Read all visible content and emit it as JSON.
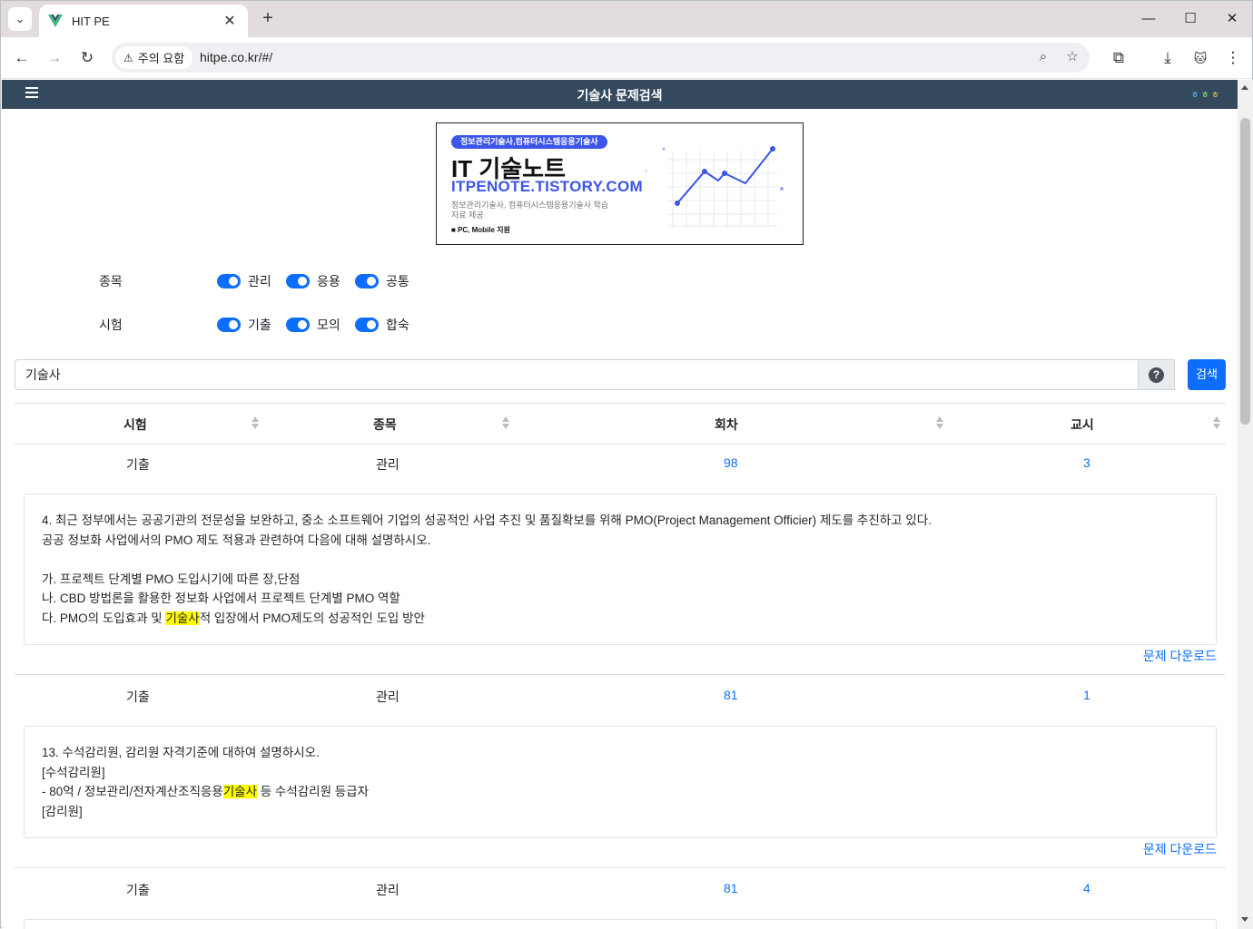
{
  "browser": {
    "tab_title": "HIT PE",
    "security_chip": "주의 요함",
    "url": "hitpe.co.kr/#/"
  },
  "app": {
    "title": "기술사 문제검색",
    "nav_deco": "ㅎㅎㅎ"
  },
  "banner": {
    "pill": "정보관리기술사,컴퓨터시스템응용기술사",
    "headline": "IT 기술노트",
    "site": "ITPENOTE.TISTORY.COM",
    "sub": "정보관리기술사, 컴퓨터시스템응용기술사 학습자료 제공",
    "platform": "■ PC, Mobile 지원"
  },
  "filters": {
    "category": {
      "label": "종목",
      "options": [
        "관리",
        "응용",
        "공통"
      ]
    },
    "exam": {
      "label": "시험",
      "options": [
        "기출",
        "모의",
        "합숙"
      ]
    }
  },
  "search": {
    "value": "기술사",
    "help": "?",
    "button": "검색"
  },
  "table": {
    "headers": [
      "시험",
      "종목",
      "회차",
      "교시"
    ],
    "rows": [
      {
        "exam": "기출",
        "category": "관리",
        "round": "98",
        "period": "3",
        "lines": [
          "4. 최근 정부에서는 공공기관의 전문성을 보완하고, 중소 소프트웨어 기업의 성공적인 사업 추진 및 품질확보를 위해 PMO(Project Management Officier) 제도를 추진하고 있다.",
          "공공 정보화 사업에서의 PMO 제도 적용과 관련하여 다음에 대해 설명하시오.",
          "",
          "가. 프로젝트 단계별 PMO 도입시기에 따른 장,단점",
          "나. CBD 방법론을 활용한 정보화 사업에서 프로젝트 단계별 PMO 역할"
        ],
        "hl_line": {
          "before": "다. PMO의 도입효과 및 ",
          "mark": "기술사",
          "after": "적 입장에서 PMO제도의 성공적인 도입 방안"
        },
        "download": "문제 다운로드"
      },
      {
        "exam": "기출",
        "category": "관리",
        "round": "81",
        "period": "1",
        "lines": [
          "13. 수석감리원, 감리원 자격기준에 대하여 설명하시오.",
          "[수석감리원]"
        ],
        "hl_line": {
          "before": "- 80억 / 정보관리/전자계산조직응용",
          "mark": "기술사",
          "after": " 등 수석감리원 등급자"
        },
        "tail": "[감리원]",
        "download": "문제 다운로드"
      },
      {
        "exam": "기출",
        "category": "관리",
        "round": "81",
        "period": "4"
      }
    ]
  }
}
